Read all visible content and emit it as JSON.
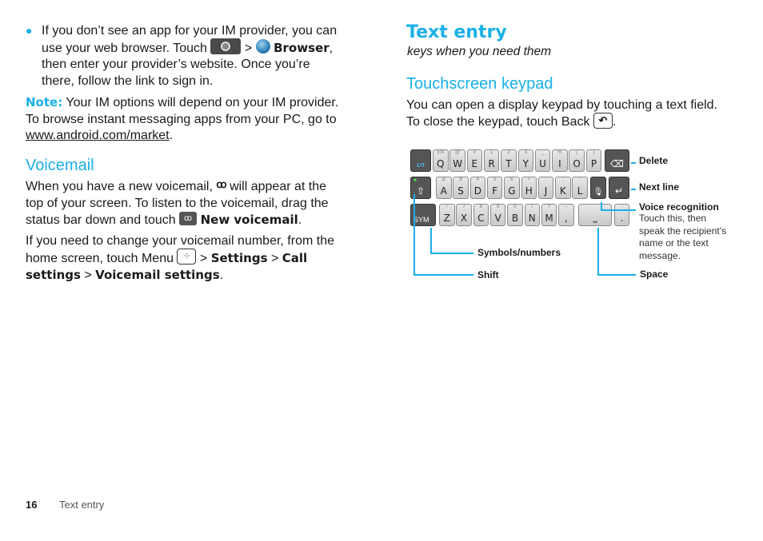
{
  "left_column": {
    "bullet_text_1": "If you don’t see an app for your IM provider, you can",
    "bullet_text_2": "use your web browser. Touch",
    "bullet_sep": ">",
    "browser_label": "Browser",
    "bullet_text_3": "then enter your provider’s website. Once you’re",
    "bullet_text_4": "there, follow the link to sign in.",
    "note_label": "Note:",
    "note_text_1": "Your IM options will depend on your IM provider.",
    "note_text_2": "To browse instant messaging apps from your PC, go to",
    "note_link": "www.android.com/market",
    "voicemail_heading": "Voicemail",
    "vm_p1_a": "When you have a new voicemail,",
    "vm_p1_b": "will appear at the",
    "vm_p1_c": "top of your screen. To listen to the voicemail, drag the",
    "vm_p1_d": "status bar down and touch",
    "new_voicemail": "New voicemail",
    "vm_p2_a": "If you need to change your voicemail number, from the",
    "vm_p2_b": "home screen, touch Menu",
    "settings": "Settings",
    "call": "Call",
    "call_settings_cont": "settings",
    "voicemail_settings": "Voicemail settings",
    "voicemail_glyph": "ꝏ"
  },
  "right_column": {
    "title": "Text entry",
    "subtitle": "keys when you need them",
    "section_heading": "Touchscreen keypad",
    "intro_1": "You can open a display keypad by touching a text field.",
    "intro_2": "To close the keypad, touch Back",
    "back_glyph": "↶"
  },
  "keyboard": {
    "row1": [
      {
        "main": "Q",
        "alt": "EN"
      },
      {
        "main": "W",
        "alt": "@"
      },
      {
        "main": "E",
        "alt": "#"
      },
      {
        "main": "R",
        "alt": "1"
      },
      {
        "main": "T",
        "alt": "2"
      },
      {
        "main": "Y",
        "alt": "3"
      },
      {
        "main": "U",
        "alt": "_"
      },
      {
        "main": "I",
        "alt": "%"
      },
      {
        "main": "O",
        "alt": "("
      },
      {
        "main": "P",
        "alt": ")"
      }
    ],
    "row2": [
      {
        "main": "A",
        "alt": "&"
      },
      {
        "main": "S",
        "alt": "$"
      },
      {
        "main": "D",
        "alt": "4"
      },
      {
        "main": "F",
        "alt": "5"
      },
      {
        "main": "G",
        "alt": "6"
      },
      {
        "main": "H",
        "alt": "+"
      },
      {
        "main": "J",
        "alt": ":"
      },
      {
        "main": "K",
        "alt": ";"
      },
      {
        "main": "L",
        "alt": "\""
      }
    ],
    "row3": [
      {
        "main": "Z",
        "alt": "!"
      },
      {
        "main": "X",
        "alt": "7"
      },
      {
        "main": "C",
        "alt": "8"
      },
      {
        "main": "V",
        "alt": "9"
      },
      {
        "main": "B",
        "alt": "0"
      },
      {
        "main": "N",
        "alt": "/"
      },
      {
        "main": "M",
        "alt": "?"
      },
      {
        "main": ",",
        "alt": "–"
      }
    ],
    "sym_label": "SYM",
    "shift_glyph": "⇧",
    "delete_glyph": "⌫",
    "enter_glyph": "↵",
    "mic_glyph": "🎙",
    "period_glyph": ".",
    "space_glyph": "⎵"
  },
  "callouts": {
    "delete": "Delete",
    "next_line": "Next line",
    "voice_recognition": "Voice recognition",
    "voice_desc_1": "Touch this, then",
    "voice_desc_2": "speak the recipient’s",
    "voice_desc_3": "name or the text",
    "voice_desc_4": "message.",
    "space": "Space",
    "symbols_numbers": "Symbols/numbers",
    "shift": "Shift"
  },
  "footer": {
    "page_number": "16",
    "section": "Text entry"
  },
  "colors": {
    "accent": "#1ab0e8"
  }
}
